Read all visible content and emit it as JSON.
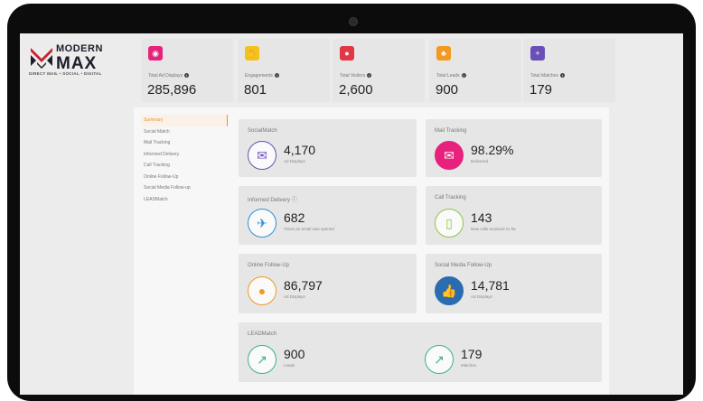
{
  "brand": {
    "line1": "MODERN",
    "line2": "MAX",
    "tagline": "DIRECT MAIL • SOCIAL • DIGITAL",
    "logo_colors": [
      "#c8202f",
      "#1d1d2b"
    ]
  },
  "stats": [
    {
      "label": "Total Ad Displays",
      "value": "285,896",
      "icon": "eye-icon",
      "color": "#e8217c"
    },
    {
      "label": "Engagements",
      "value": "801",
      "icon": "hand-icon",
      "color": "#f2c21b"
    },
    {
      "label": "Total Visitors",
      "value": "2,600",
      "icon": "user-icon",
      "color": "#e23646"
    },
    {
      "label": "Total Leads",
      "value": "900",
      "icon": "group-icon",
      "color": "#f29a1f"
    },
    {
      "label": "Total Matches",
      "value": "179",
      "icon": "add-user-icon",
      "color": "#6b4fb8"
    }
  ],
  "nav": {
    "items": [
      "Summary",
      "Social Match",
      "Mail Tracking",
      "Informed Delivery",
      "Call Tracking",
      "Online Follow-Up",
      "Social Media Follow-up",
      "LEADMatch"
    ],
    "active": "Summary",
    "accent": "#e8923a"
  },
  "cards": {
    "socialmatch": {
      "title": "SocialMatch",
      "value": "4,170",
      "sub": "Ad Displays",
      "icon": "mail-card-icon",
      "color": "#6b4fb8"
    },
    "mail": {
      "title": "Mail Tracking",
      "value": "98.29%",
      "sub": "Delivered",
      "icon": "envelope-icon",
      "color": "#e8217c"
    },
    "informed": {
      "title": "Informed Delivery",
      "value": "682",
      "sub": "Times an email was opened",
      "icon": "delivery-icon",
      "color": "#2f8fd8"
    },
    "call": {
      "title": "Call Tracking",
      "value": "143",
      "sub": "New calls received so far",
      "icon": "phone-icon",
      "color": "#8cc63f"
    },
    "online": {
      "title": "Online Follow-Up",
      "value": "86,797",
      "sub": "Ad Displays",
      "icon": "cursor-icon",
      "color": "#f29a1f"
    },
    "social": {
      "title": "Social Media Follow-Up",
      "value": "14,781",
      "sub": "Ad Displays",
      "icon": "thumbs-up-icon",
      "color": "#2b6cb0"
    },
    "lead": {
      "title": "LEADMatch",
      "leads_value": "900",
      "leads_sub": "Leads",
      "matches_value": "179",
      "matches_sub": "Matches",
      "icon": "trend-icon",
      "color": "#3bb08f"
    }
  }
}
